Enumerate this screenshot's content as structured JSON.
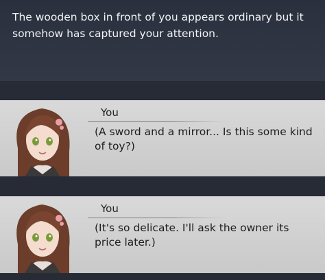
{
  "narration": {
    "text": "The wooden box in front of you appears ordinary but it somehow has captured your attention."
  },
  "dialogues": [
    {
      "speaker": "You",
      "line": "(A sword and a mirror... Is this some kind of toy?)"
    },
    {
      "speaker": "You",
      "line": "(It's so delicate. I'll ask the owner its price later.)"
    }
  ],
  "colors": {
    "background": "#2b3140",
    "dialog_box": "#d3d3d3",
    "hair": "#6b3d2a",
    "eyes": "#7a9a3a"
  },
  "icons": {
    "portrait": "heroine-portrait"
  }
}
